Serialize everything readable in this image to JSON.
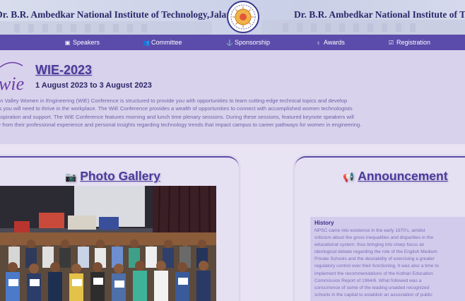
{
  "banner": {
    "left_text": "Dr. B.R. Ambedkar National Institute of Technology,Jalandhar",
    "right_text": "Dr. B.R. Ambedkar National Institute of Technology,Jalandhar"
  },
  "nav": {
    "items": [
      {
        "label": "Speakers",
        "icon": "projector-icon"
      },
      {
        "label": "Committee",
        "icon": "users-icon"
      },
      {
        "label": "Sponsorship",
        "icon": "handshake-icon"
      },
      {
        "label": "Awards",
        "icon": "award-icon"
      },
      {
        "label": "Registration",
        "icon": "form-icon"
      }
    ]
  },
  "intro": {
    "logo_text": "wie",
    "title": "WIE-2023",
    "date": "1 August 2023 to 3 August 2023",
    "description_lines": [
      "Silicon Valley Women in Engineering (WiE) Conference is structured to provide you with opportunities to learn cutting-edge technical topics and develop",
      "skills you will need to thrive in the workplace. The WiE Conference provides a wealth of opportunities to connect with accomplished women technologists",
      "for inspiration and support. The WiE Conference features morning and lunch time plenary sessions. During these sessions, featured keynote speakers will",
      "share from their professional experience and personal insights regarding technology trends that impact campus to career pathways for women in engineering."
    ]
  },
  "gallery": {
    "title": "Photo Gallery",
    "icon": "camera-icon"
  },
  "announcement": {
    "title": "Announcement",
    "icon": "megaphone-icon",
    "history_heading": "History",
    "history_lines": [
      "NPSC came into existence in the early 1970's, amidst",
      "criticism about the gross inequalities and disparities in the",
      "educational system; thus bringing into sharp focus an",
      "ideological debate regarding the role of the English Medium",
      "Private Schools and the desirability of exercising a greater",
      "regulatory control over their functioning. It was also a time to",
      "implement the recommendations of the Kothari Education",
      "Commission Report of 1964/6. What followed was a",
      "concurrence of some of the leading unaided recognized",
      "schools in the capital to establish an association of public"
    ]
  },
  "colors": {
    "nav_bg": "#5b4baa",
    "heading": "#4a3b9b",
    "intro_bg": "#d9d2ec",
    "page_bg": "#e9e4f3"
  }
}
